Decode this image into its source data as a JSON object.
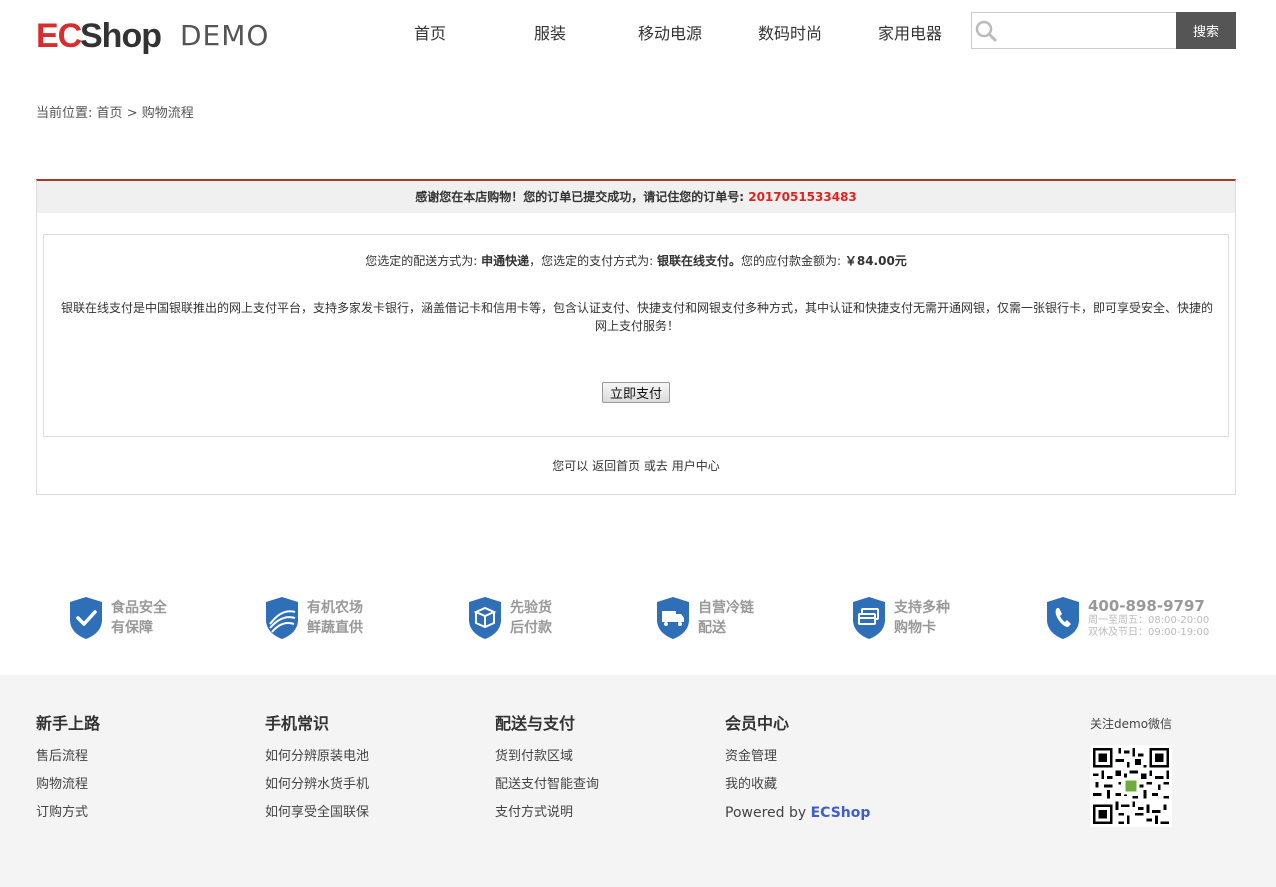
{
  "header": {
    "logo_text_ec": "ECS",
    "logo_text_hop": "hop",
    "logo_text_demo": "DEMO",
    "nav": [
      "首页",
      "服装",
      "移动电源",
      "数码时尚",
      "家用电器"
    ],
    "search_placeholder": "",
    "search_button": "搜索"
  },
  "breadcrumb": {
    "prefix": "当前位置:",
    "home": "首页",
    "separator": ">",
    "current": "购物流程"
  },
  "order": {
    "thanks": "感谢您在本店购物！您的订单已提交成功，请记住您的订单号:",
    "order_number": "2017051533483",
    "shipping_label": "您选定的配送方式为:",
    "shipping_value": "申通快递",
    "payment_label": "，您选定的支付方式为:",
    "payment_value": "银联在线支付。",
    "amount_label": "您的应付款金额为:",
    "amount_value": "￥84.00元",
    "description": "银联在线支付是中国银联推出的网上支付平台，支持多家发卡银行，涵盖借记卡和信用卡等，包含认证支付、快捷支付和网银支付多种方式，其中认证和快捷支付无需开通网银，仅需一张银行卡，即可享受安全、快捷的网上支付服务！",
    "pay_button": "立即支付",
    "back_prefix": "您可以",
    "back_home": "返回首页",
    "back_or": "或去",
    "back_user": "用户中心"
  },
  "features": [
    {
      "line1": "食品安全",
      "line2": "有保障",
      "icon": "check-shield-icon"
    },
    {
      "line1": "有机农场",
      "line2": "鲜蔬直供",
      "icon": "farm-shield-icon"
    },
    {
      "line1": "先验货",
      "line2": "后付款",
      "icon": "box-shield-icon"
    },
    {
      "line1": "自营冷链",
      "line2": "配送",
      "icon": "truck-shield-icon"
    },
    {
      "line1": "支持多种",
      "line2": "购物卡",
      "icon": "card-shield-icon"
    }
  ],
  "hotline": {
    "phone": "400-898-9797",
    "hours1": "周一至周五：08:00-20:00",
    "hours2": "双休及节日：09:00-19:00"
  },
  "footer": {
    "columns": [
      {
        "title": "新手上路",
        "links": [
          "售后流程",
          "购物流程",
          "订购方式"
        ]
      },
      {
        "title": "手机常识",
        "links": [
          "如何分辨原装电池",
          "如何分辨水货手机",
          "如何享受全国联保"
        ]
      },
      {
        "title": "配送与支付",
        "links": [
          "货到付款区域",
          "配送支付智能查询",
          "支付方式说明"
        ]
      },
      {
        "title": "会员中心",
        "links": [
          "资金管理",
          "我的收藏"
        ]
      }
    ],
    "powered_by": "Powered by",
    "powered_brand": "ECShop",
    "qr_label": "关注demo微信"
  },
  "colors": {
    "accent_red": "#e0231e",
    "shield_blue": "#2f6fb8",
    "search_button": "#555555"
  }
}
